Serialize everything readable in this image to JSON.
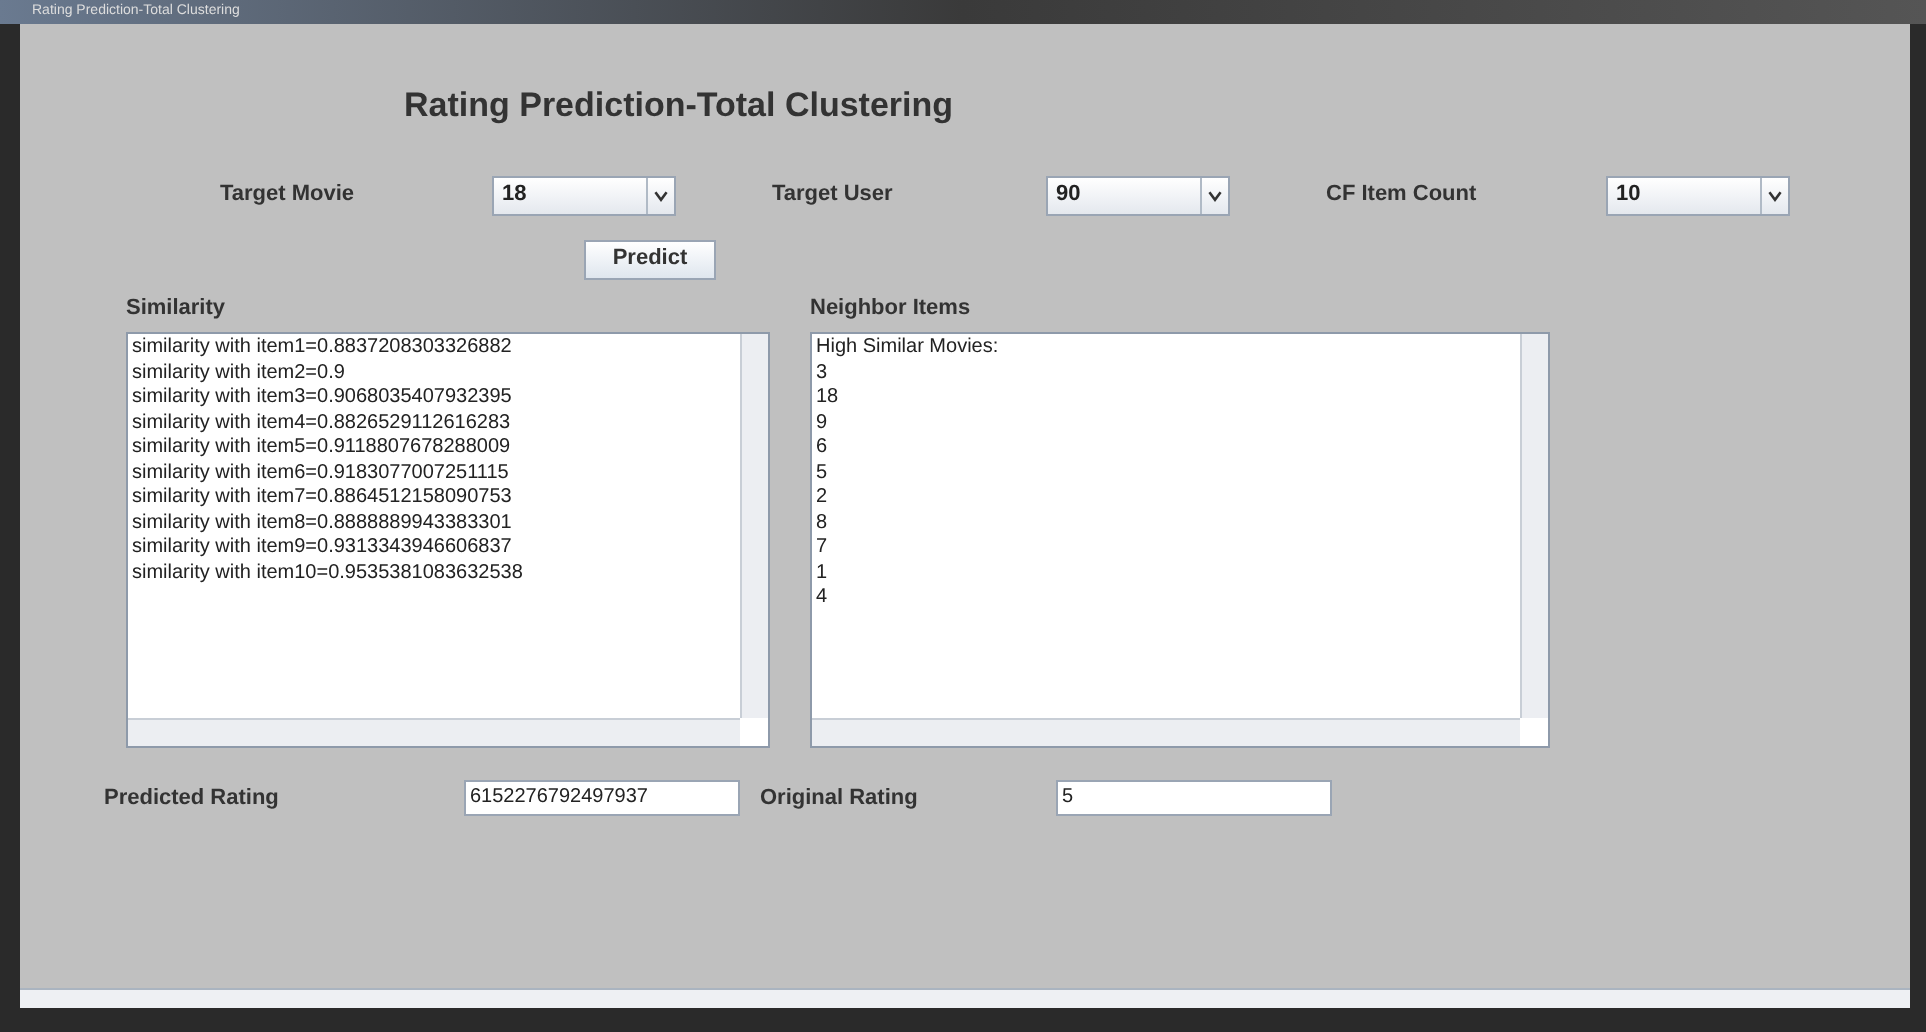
{
  "window": {
    "title": "Rating Prediction-Total Clustering"
  },
  "heading": "Rating Prediction-Total Clustering",
  "selectors": [
    {
      "label": "Target Movie",
      "value": "18"
    },
    {
      "label": "Target User",
      "value": "90"
    },
    {
      "label": "CF Item Count",
      "value": "10"
    }
  ],
  "predict_button": "Predict",
  "similarity": {
    "label": "Similarity",
    "lines": [
      "similarity with item1=0.8837208303326882",
      "similarity with item2=0.9",
      "similarity with item3=0.9068035407932395",
      "similarity with item4=0.8826529112616283",
      "similarity with item5=0.9118807678288009",
      "similarity with item6=0.9183077007251115",
      "similarity with item7=0.8864512158090753",
      "similarity with item8=0.8888889943383301",
      "similarity with item9=0.9313343946606837",
      "similarity with item10=0.9535381083632538"
    ]
  },
  "neighbors": {
    "label": "Neighbor Items",
    "lines": [
      "High Similar Movies:",
      "3",
      "18",
      "9",
      "6",
      "5",
      "2",
      "8",
      "7",
      "1",
      "4"
    ]
  },
  "predicted": {
    "label": "Predicted Rating",
    "value": "6152276792497937"
  },
  "original": {
    "label": "Original Rating",
    "value": "5"
  }
}
